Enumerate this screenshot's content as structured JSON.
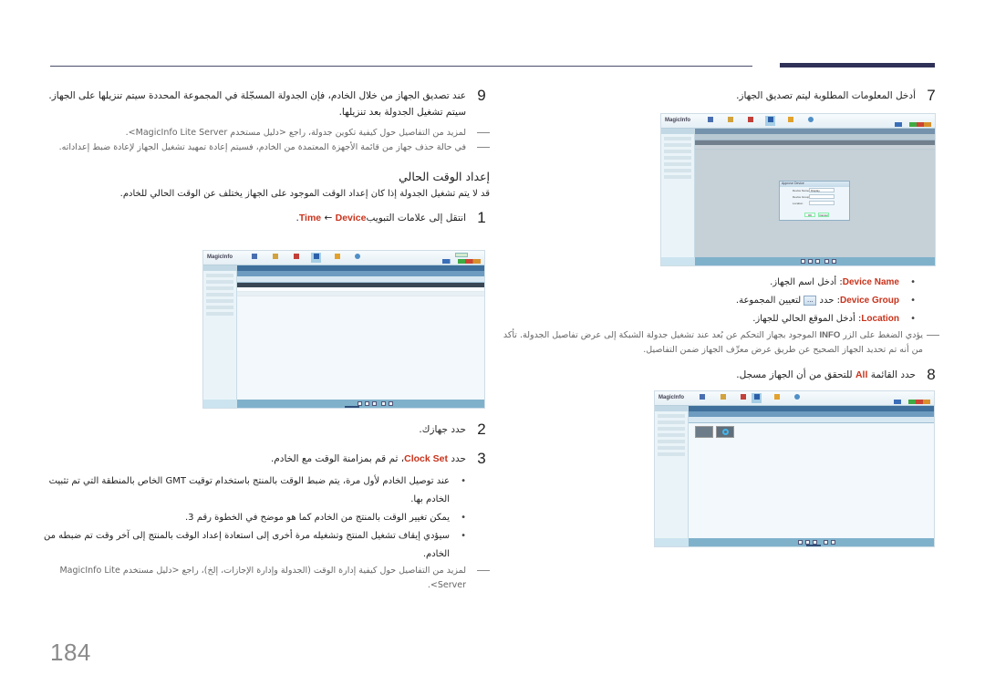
{
  "page": {
    "number": "184",
    "accent_color": "#c8331c",
    "rule_color": "#2f3157"
  },
  "left_column": {
    "step9": {
      "num": "9",
      "text": "عند تصديق الجهاز من خلال الخادم، فإن الجدولة المسجّلة في المجموعة المحددة سيتم تنزيلها على الجهاز. سيتم تشغيل الجدولة بعد تنزيلها.",
      "notes": [
        "لمزيد من التفاصيل حول كيفية تكوين جدولة، راجع <دليل مستخدم MagicInfo Lite Server>.",
        "في حالة حذف جهاز من قائمة الأجهزة المعتمدة من الخادم، فسيتم إعادة تمهيد تشغيل الجهاز لإعادة ضبط إعداداته."
      ]
    },
    "section": {
      "title": "إعداد الوقت الحالي",
      "intro": "قد لا يتم تشغيل الجدولة إذا كان إعداد الوقت الموجود على الجهاز يختلف عن الوقت الحالي للخادم."
    },
    "step1": {
      "num": "1",
      "prefix": "انتقل إلى علامات التبويب",
      "hl_a": "Time",
      "arrow": " ← ",
      "hl_b": "Device",
      "suffix": "."
    },
    "step2": {
      "num": "2",
      "text": "حدد جهازك."
    },
    "step3": {
      "num": "3",
      "prefix": "حدد ",
      "hl": "Clock Set",
      "suffix": "، ثم قم بمزامنة الوقت مع الخادم."
    },
    "bullets": [
      "عند توصيل الخادم لأول مرة، يتم ضبط الوقت بالمنتج باستخدام توقيت GMT الخاص بالمنطقة التي تم تثبيت الخادم بها.",
      "يمكن تغيير الوقت بالمنتج من الخادم كما هو موضح في الخطوة رقم 3.",
      "سيؤدي إيقاف تشغيل المنتج وتشغيله مرة أخرى إلى استعادة إعداد الوقت بالمنتج إلى آخر وقت تم ضبطه من الخادم."
    ],
    "final_note": "لمزيد من التفاصيل حول كيفية إدارة الوقت (الجدولة وإدارة الإجازات، إلخ)، راجع <دليل مستخدم MagicInfo Lite Server>."
  },
  "right_column": {
    "step7": {
      "num": "7",
      "text": "أدخل المعلومات المطلوبة ليتم تصديق الجهاز."
    },
    "fields": [
      {
        "label": "Device Name",
        "text": ": أدخل اسم الجهاز."
      },
      {
        "label": "Device Group",
        "text_before": ": حدد ",
        "button": "...",
        "text_after": " لتعيين المجموعة."
      },
      {
        "label": "Location",
        "text": ": أدخل الموقع الحالي للجهاز."
      }
    ],
    "info_note": {
      "before": "يؤدي الضغط على الزر ",
      "key": "INFO",
      "after": " الموجود بجهاز التحكم عن بُعد عند تشغيل جدولة الشبكة إلى عرض تفاصيل الجدولة. تأكد من أنه تم تحديد الجهاز الصحيح عن طريق عرض معرِّف الجهاز ضمن التفاصيل."
    },
    "step8": {
      "num": "8",
      "prefix": "حدد القائمة ",
      "hl": "All",
      "suffix": " للتحقق من أن الجهاز مسجل."
    }
  },
  "screenshots": {
    "app_name": "MagicInfo",
    "approve_dialog": {
      "title": "Approve Device",
      "fields": [
        "Device Name",
        "Device Group",
        "Location"
      ],
      "device_name_value": "Display",
      "ok_label": "OK",
      "cancel_label": "Cancel"
    }
  }
}
